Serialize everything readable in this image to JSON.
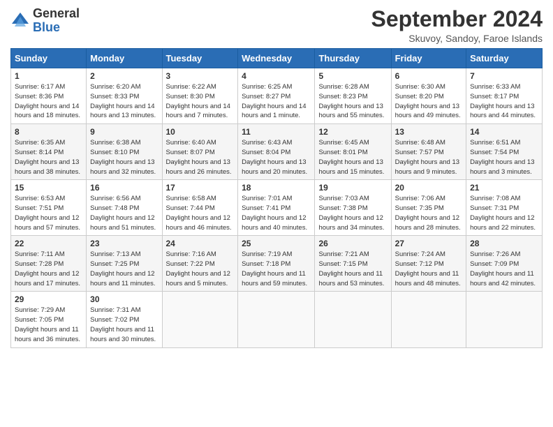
{
  "header": {
    "logo_line1": "General",
    "logo_line2": "Blue",
    "month": "September 2024",
    "location": "Skuvoy, Sandoy, Faroe Islands"
  },
  "weekdays": [
    "Sunday",
    "Monday",
    "Tuesday",
    "Wednesday",
    "Thursday",
    "Friday",
    "Saturday"
  ],
  "weeks": [
    [
      {
        "day": "1",
        "sunrise": "6:17 AM",
        "sunset": "8:36 PM",
        "daylight": "14 hours and 18 minutes."
      },
      {
        "day": "2",
        "sunrise": "6:20 AM",
        "sunset": "8:33 PM",
        "daylight": "14 hours and 13 minutes."
      },
      {
        "day": "3",
        "sunrise": "6:22 AM",
        "sunset": "8:30 PM",
        "daylight": "14 hours and 7 minutes."
      },
      {
        "day": "4",
        "sunrise": "6:25 AM",
        "sunset": "8:27 PM",
        "daylight": "14 hours and 1 minute."
      },
      {
        "day": "5",
        "sunrise": "6:28 AM",
        "sunset": "8:23 PM",
        "daylight": "13 hours and 55 minutes."
      },
      {
        "day": "6",
        "sunrise": "6:30 AM",
        "sunset": "8:20 PM",
        "daylight": "13 hours and 49 minutes."
      },
      {
        "day": "7",
        "sunrise": "6:33 AM",
        "sunset": "8:17 PM",
        "daylight": "13 hours and 44 minutes."
      }
    ],
    [
      {
        "day": "8",
        "sunrise": "6:35 AM",
        "sunset": "8:14 PM",
        "daylight": "13 hours and 38 minutes."
      },
      {
        "day": "9",
        "sunrise": "6:38 AM",
        "sunset": "8:10 PM",
        "daylight": "13 hours and 32 minutes."
      },
      {
        "day": "10",
        "sunrise": "6:40 AM",
        "sunset": "8:07 PM",
        "daylight": "13 hours and 26 minutes."
      },
      {
        "day": "11",
        "sunrise": "6:43 AM",
        "sunset": "8:04 PM",
        "daylight": "13 hours and 20 minutes."
      },
      {
        "day": "12",
        "sunrise": "6:45 AM",
        "sunset": "8:01 PM",
        "daylight": "13 hours and 15 minutes."
      },
      {
        "day": "13",
        "sunrise": "6:48 AM",
        "sunset": "7:57 PM",
        "daylight": "13 hours and 9 minutes."
      },
      {
        "day": "14",
        "sunrise": "6:51 AM",
        "sunset": "7:54 PM",
        "daylight": "13 hours and 3 minutes."
      }
    ],
    [
      {
        "day": "15",
        "sunrise": "6:53 AM",
        "sunset": "7:51 PM",
        "daylight": "12 hours and 57 minutes."
      },
      {
        "day": "16",
        "sunrise": "6:56 AM",
        "sunset": "7:48 PM",
        "daylight": "12 hours and 51 minutes."
      },
      {
        "day": "17",
        "sunrise": "6:58 AM",
        "sunset": "7:44 PM",
        "daylight": "12 hours and 46 minutes."
      },
      {
        "day": "18",
        "sunrise": "7:01 AM",
        "sunset": "7:41 PM",
        "daylight": "12 hours and 40 minutes."
      },
      {
        "day": "19",
        "sunrise": "7:03 AM",
        "sunset": "7:38 PM",
        "daylight": "12 hours and 34 minutes."
      },
      {
        "day": "20",
        "sunrise": "7:06 AM",
        "sunset": "7:35 PM",
        "daylight": "12 hours and 28 minutes."
      },
      {
        "day": "21",
        "sunrise": "7:08 AM",
        "sunset": "7:31 PM",
        "daylight": "12 hours and 22 minutes."
      }
    ],
    [
      {
        "day": "22",
        "sunrise": "7:11 AM",
        "sunset": "7:28 PM",
        "daylight": "12 hours and 17 minutes."
      },
      {
        "day": "23",
        "sunrise": "7:13 AM",
        "sunset": "7:25 PM",
        "daylight": "12 hours and 11 minutes."
      },
      {
        "day": "24",
        "sunrise": "7:16 AM",
        "sunset": "7:22 PM",
        "daylight": "12 hours and 5 minutes."
      },
      {
        "day": "25",
        "sunrise": "7:19 AM",
        "sunset": "7:18 PM",
        "daylight": "11 hours and 59 minutes."
      },
      {
        "day": "26",
        "sunrise": "7:21 AM",
        "sunset": "7:15 PM",
        "daylight": "11 hours and 53 minutes."
      },
      {
        "day": "27",
        "sunrise": "7:24 AM",
        "sunset": "7:12 PM",
        "daylight": "11 hours and 48 minutes."
      },
      {
        "day": "28",
        "sunrise": "7:26 AM",
        "sunset": "7:09 PM",
        "daylight": "11 hours and 42 minutes."
      }
    ],
    [
      {
        "day": "29",
        "sunrise": "7:29 AM",
        "sunset": "7:05 PM",
        "daylight": "11 hours and 36 minutes."
      },
      {
        "day": "30",
        "sunrise": "7:31 AM",
        "sunset": "7:02 PM",
        "daylight": "11 hours and 30 minutes."
      },
      null,
      null,
      null,
      null,
      null
    ]
  ]
}
